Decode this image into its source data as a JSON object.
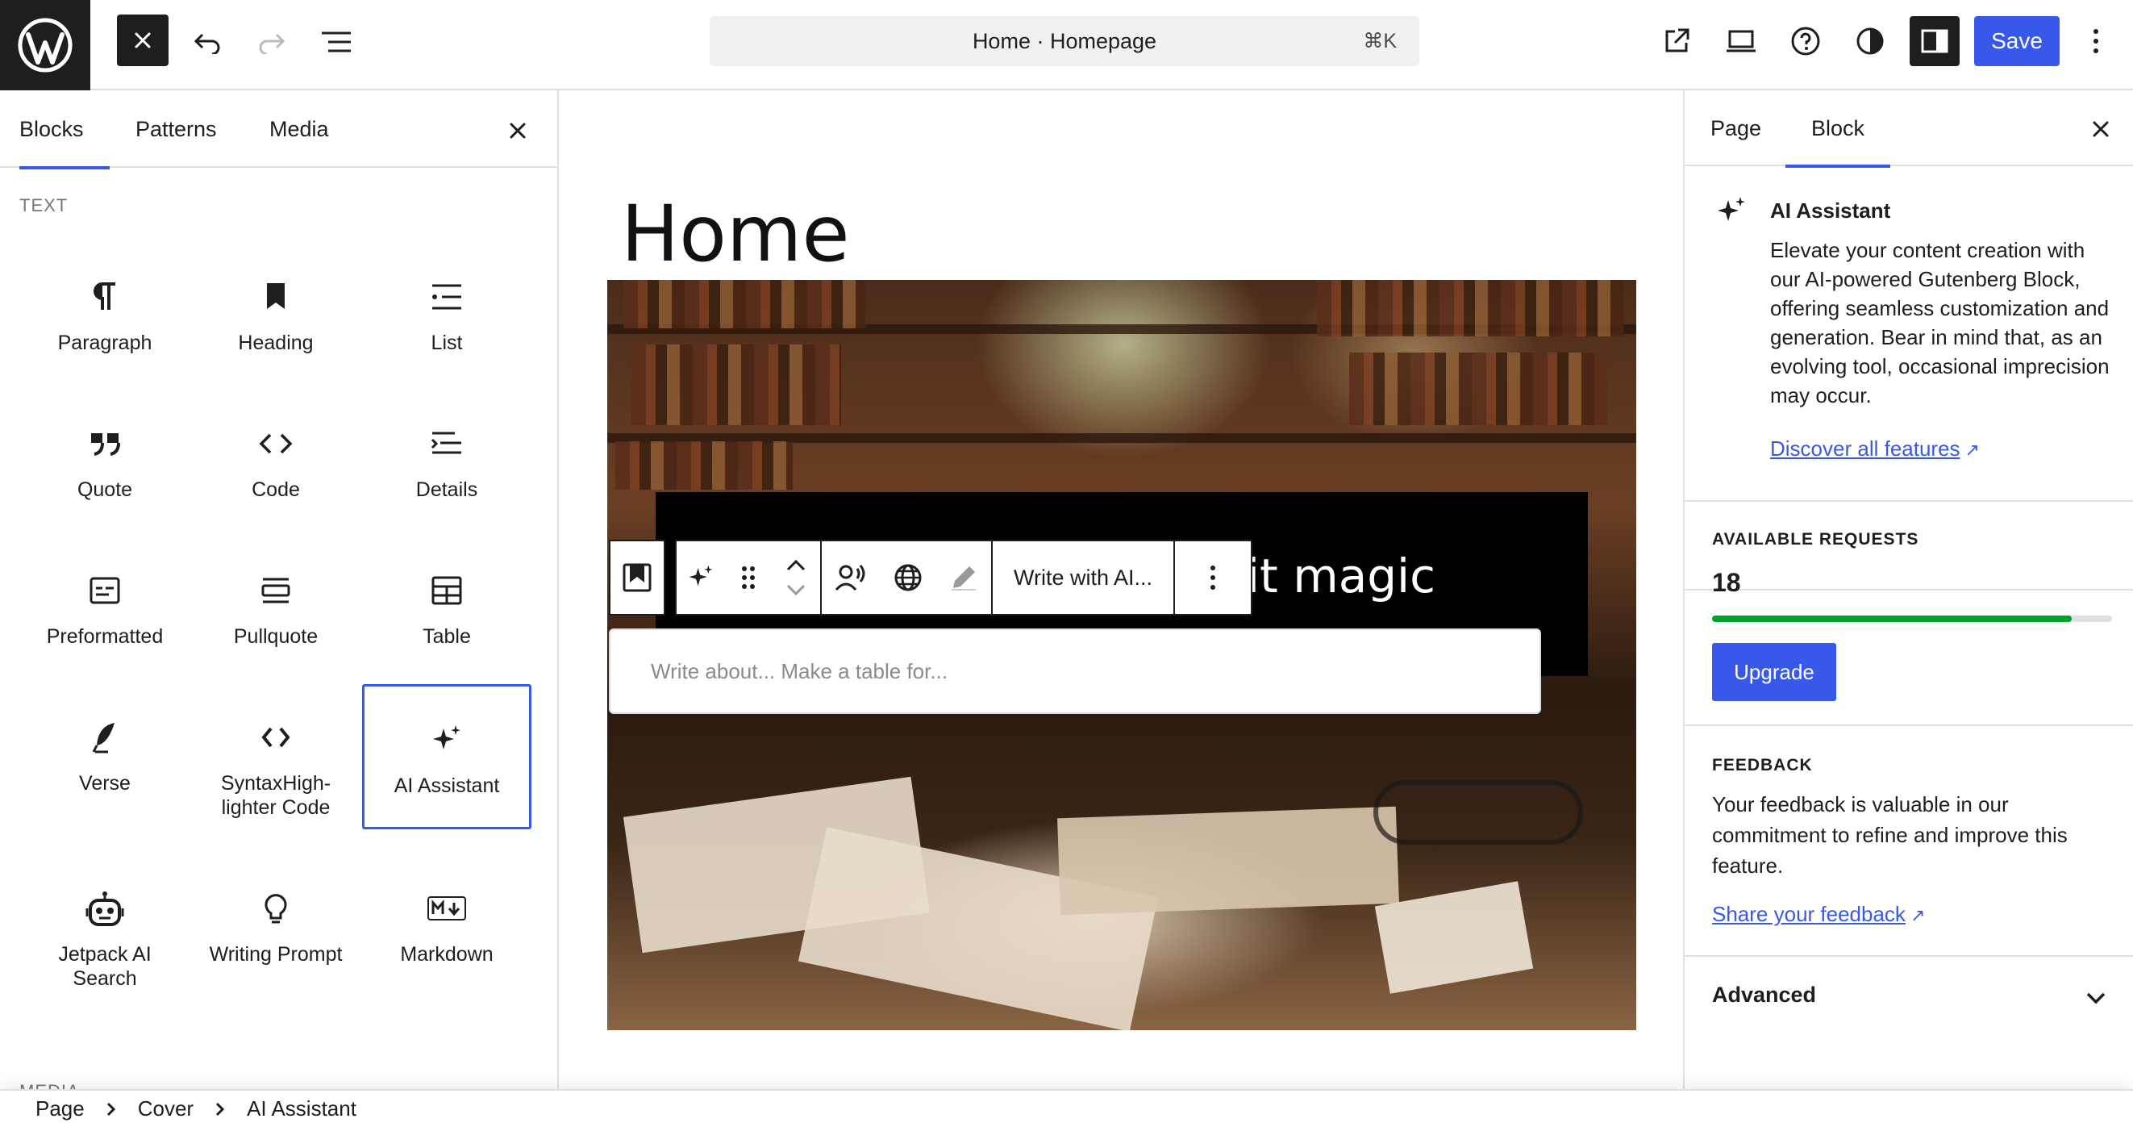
{
  "header": {
    "command_title": "Home · Homepage",
    "command_shortcut": "⌘K",
    "save_label": "Save"
  },
  "inserter": {
    "tabs": [
      {
        "label": "Blocks"
      },
      {
        "label": "Patterns"
      },
      {
        "label": "Media"
      }
    ],
    "section_label": "TEXT",
    "next_section_label": "MEDIA",
    "blocks": [
      {
        "label": "Paragraph",
        "icon": "paragraph-icon"
      },
      {
        "label": "Heading",
        "icon": "heading-icon"
      },
      {
        "label": "List",
        "icon": "list-icon"
      },
      {
        "label": "Quote",
        "icon": "quote-icon"
      },
      {
        "label": "Code",
        "icon": "code-icon"
      },
      {
        "label": "Details",
        "icon": "details-icon"
      },
      {
        "label": "Preformatted",
        "icon": "preformatted-icon"
      },
      {
        "label": "Pullquote",
        "icon": "pullquote-icon"
      },
      {
        "label": "Table",
        "icon": "table-icon"
      },
      {
        "label": "Verse",
        "icon": "verse-icon"
      },
      {
        "label": "SyntaxHigh-lighter Code",
        "icon": "syntax-code-icon"
      },
      {
        "label": "AI Assistant",
        "icon": "sparkles-icon",
        "selected": true
      },
      {
        "label": "Jetpack AI Search",
        "icon": "robot-icon"
      },
      {
        "label": "Writing Prompt",
        "icon": "lightbulb-icon"
      },
      {
        "label": "Markdown",
        "icon": "markdown-icon"
      }
    ]
  },
  "canvas": {
    "page_title": "Home",
    "cover_heading": "Books are a little bit magic",
    "toolbar": {
      "write_label": "Write with AI..."
    },
    "ai_input_placeholder": "Write about... Make a table for..."
  },
  "sidebar": {
    "tabs": [
      {
        "label": "Page"
      },
      {
        "label": "Block"
      }
    ],
    "ai_title": "AI Assistant",
    "ai_description": "Elevate your content creation with our AI-powered Gutenberg Block, offering seamless customization and generation. Bear in mind that, as an evolving tool, occasional imprecision may occur.",
    "discover_link": "Discover all features",
    "requests_label": "AVAILABLE REQUESTS",
    "requests_count": "18",
    "requests_fraction": 0.9,
    "upgrade_label": "Upgrade",
    "feedback_label": "FEEDBACK",
    "feedback_text": "Your feedback is valuable in our commitment to refine and improve this feature.",
    "feedback_link": "Share your feedback",
    "advanced_label": "Advanced"
  },
  "footer": {
    "breadcrumbs": [
      "Page",
      "Cover",
      "AI Assistant"
    ]
  },
  "colors": {
    "accent": "#3858e9",
    "progress": "#00a32a",
    "dark": "#1e1e1e"
  }
}
